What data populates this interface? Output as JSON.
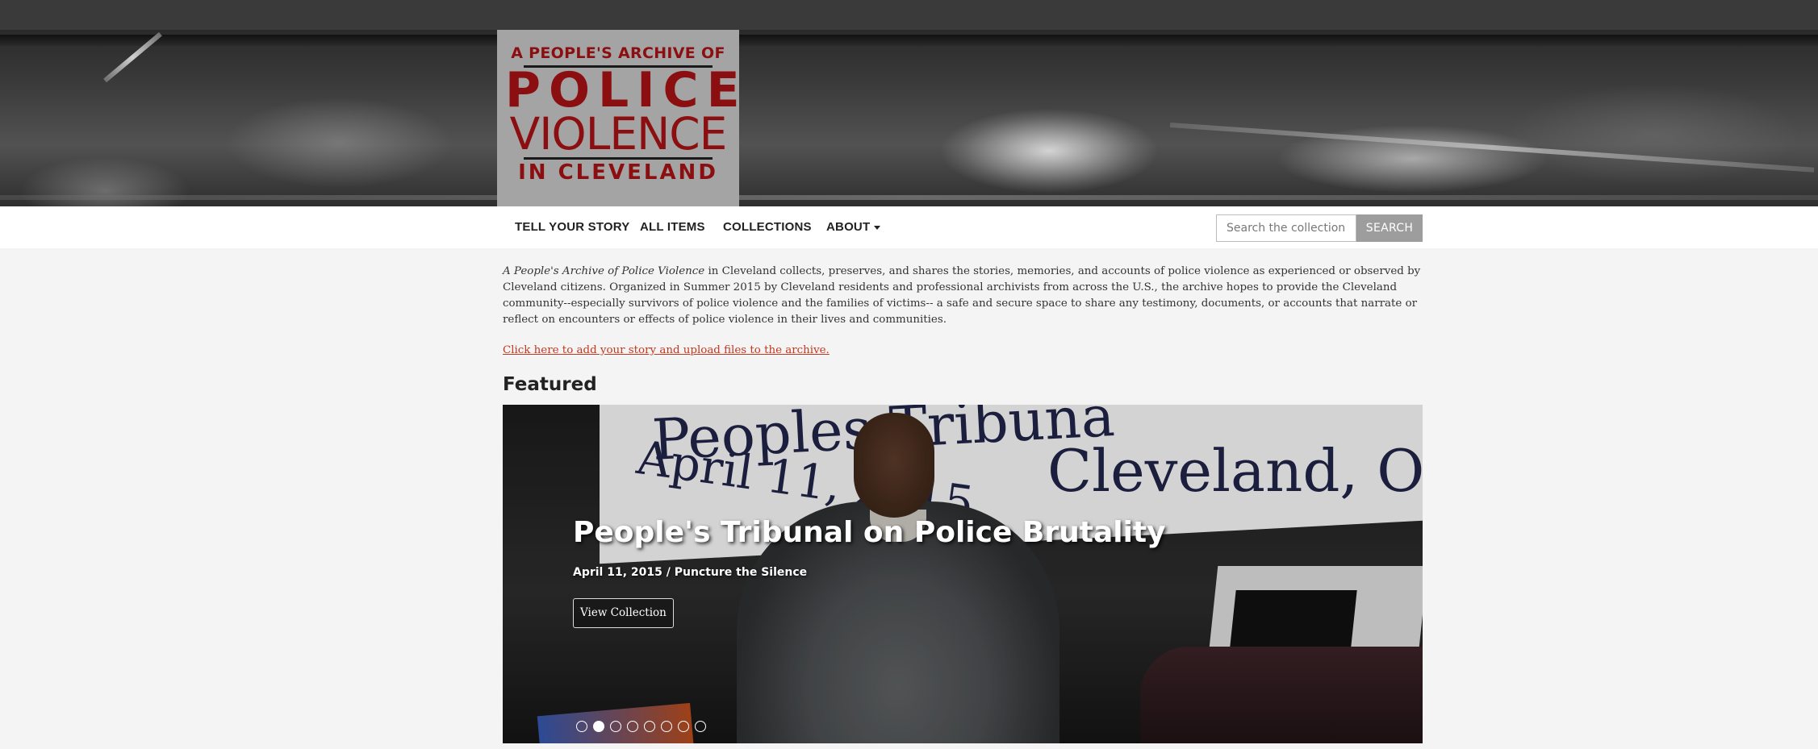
{
  "logo": {
    "line1": "A PEOPLE'S ARCHIVE OF",
    "line2": "POLICE",
    "line3": "VIOLENCE",
    "line4": "IN CLEVELAND"
  },
  "nav": {
    "items": [
      {
        "label": "TELL YOUR STORY"
      },
      {
        "label": "ALL ITEMS"
      },
      {
        "label": "COLLECTIONS"
      },
      {
        "label": "ABOUT"
      }
    ],
    "search_placeholder": "Search the collection",
    "search_button": "SEARCH"
  },
  "intro": {
    "archive_title": "A People's Archive of Police Violence",
    "body": " in Cleveland collects, preserves, and shares the stories, memories, and accounts of police violence as experienced or observed by Cleveland citizens. Organized in Summer 2015 by Cleveland residents and professional archivists from across the U.S., the archive hopes to provide the Cleveland community--especially survivors of police violence and the families of victims-- a safe and secure space to share any testimony, documents, or accounts that narrate or reflect on encounters or effects of police violence in their lives and communities.",
    "upload_link": "Click here to add your story and upload files to the archive."
  },
  "featured": {
    "heading": "Featured",
    "slide": {
      "title": "People's Tribunal on Police Brutality",
      "meta": "April 11, 2015 / Puncture the Silence",
      "button": "View Collection",
      "photo_sign_text": [
        "Peoples Tribuna",
        "April 11, 2015",
        "Cleveland, Oh"
      ]
    },
    "dots_count": 8,
    "active_dot": 2
  },
  "colors": {
    "topbar": "#3a3a3a",
    "logo_red": "#8b0f10",
    "link": "#c3381f",
    "search_button_bg": "#9d9d9d"
  }
}
